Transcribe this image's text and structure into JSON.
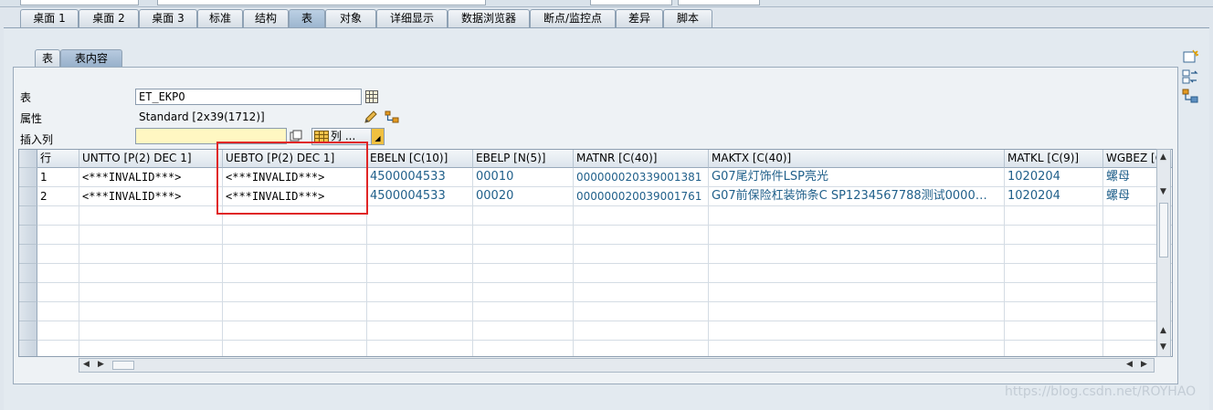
{
  "main_tabs": [
    {
      "label": "桌面 1",
      "active": false
    },
    {
      "label": "桌面 2",
      "active": false
    },
    {
      "label": "桌面 3",
      "active": false
    },
    {
      "label": "标准",
      "active": false
    },
    {
      "label": "结构",
      "active": false
    },
    {
      "label": "表",
      "active": true
    },
    {
      "label": "对象",
      "active": false
    },
    {
      "label": "详细显示",
      "active": false
    },
    {
      "label": "数据浏览器",
      "active": false
    },
    {
      "label": "断点/监控点",
      "active": false
    },
    {
      "label": "差异",
      "active": false
    },
    {
      "label": "脚本",
      "active": false
    }
  ],
  "sub_tabs": [
    {
      "label": "表",
      "active": false
    },
    {
      "label": "表内容",
      "active": true
    }
  ],
  "form": {
    "table_label": "表",
    "table_value": "ET_EKPO",
    "attr_label": "属性",
    "attr_value": "Standard [2x39(1712)]",
    "insert_label": "插入列",
    "insert_value": "",
    "col_button": "列 ..."
  },
  "grid": {
    "columns": [
      "行",
      "UNTTO [P(2) DEC 1]",
      "UEBTO [P(2) DEC 1]",
      "EBELN [C(10)]",
      "EBELP [N(5)]",
      "MATNR [C(40)]",
      "MAKTX [C(40)]",
      "MATKL [C(9)]",
      "WGBEZ [C"
    ],
    "rows": [
      [
        "1",
        "<***INVALID***>",
        "<***INVALID***>",
        "4500004533",
        "00010",
        "000000020339001381",
        "G07尾灯饰件LSP亮光",
        "1020204",
        "螺母"
      ],
      [
        "2",
        "<***INVALID***>",
        "<***INVALID***>",
        "4500004533",
        "00020",
        "000000020039001761",
        "G07前保险杠装饰条C SP1234567788测试0000…",
        "1020204",
        "螺母"
      ]
    ]
  },
  "watermark": "https://blog.csdn.net/ROYHAO"
}
